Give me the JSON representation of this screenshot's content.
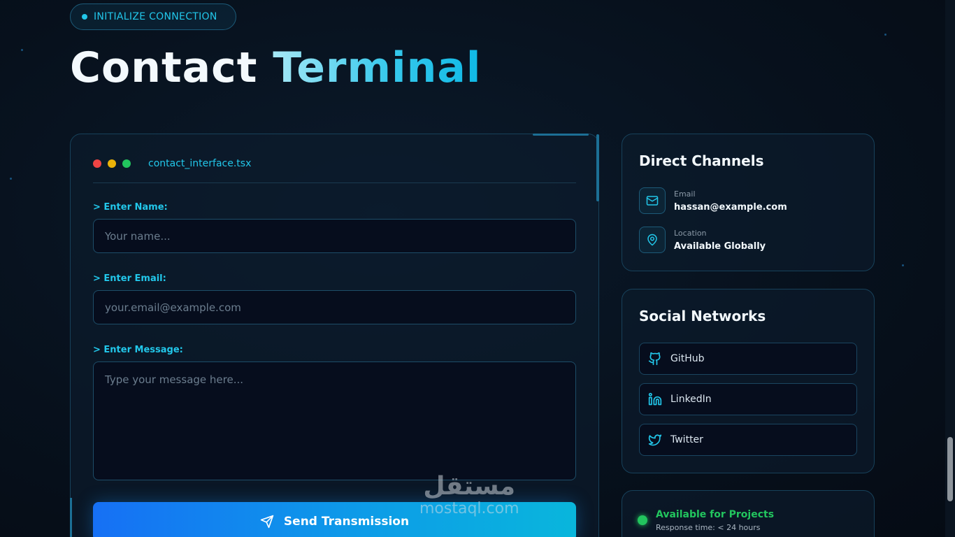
{
  "badge": {
    "label": "INITIALIZE CONNECTION"
  },
  "hero": {
    "title_part1": "Contact",
    "title_part2": "Terminal"
  },
  "form": {
    "filename": "contact_interface.tsx",
    "name_label": "> Enter Name:",
    "name_placeholder": "Your name...",
    "email_label": "> Enter Email:",
    "email_placeholder": "your.email@example.com",
    "message_label": "> Enter Message:",
    "message_placeholder": "Type your message here...",
    "submit_label": "Send Transmission"
  },
  "direct_channels": {
    "title": "Direct Channels",
    "items": [
      {
        "icon": "mail-icon",
        "label": "Email",
        "value": "hassan@example.com"
      },
      {
        "icon": "map-pin-icon",
        "label": "Location",
        "value": "Available Globally"
      }
    ]
  },
  "social_networks": {
    "title": "Social Networks",
    "items": [
      {
        "icon": "github-icon",
        "label": "GitHub"
      },
      {
        "icon": "linkedin-icon",
        "label": "LinkedIn"
      },
      {
        "icon": "twitter-icon",
        "label": "Twitter"
      }
    ]
  },
  "availability": {
    "title": "Available for Projects",
    "subtitle": "Response time: < 24 hours"
  },
  "watermark": {
    "arabic": "مستقل",
    "latin": "mostaql.com"
  },
  "colors": {
    "accent": "#22c7ea",
    "success": "#22c55e",
    "button_start": "#1670f5",
    "button_end": "#09b6dc"
  }
}
